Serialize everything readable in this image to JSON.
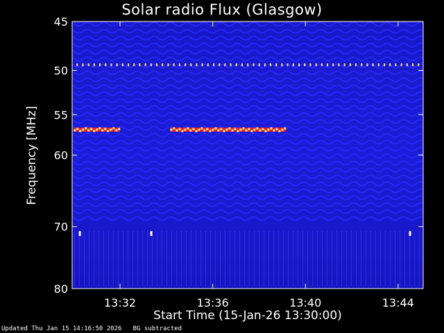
{
  "chart_data": {
    "type": "heatmap",
    "title": "Solar radio Flux (Glasgow)",
    "xlabel": "Start Time (15-Jan-26 13:30:00)",
    "ylabel": "Frequency [MHz]",
    "x_range": [
      "13:29:56",
      "13:45:05"
    ],
    "y_range": [
      45,
      80
    ],
    "y_scale": "log",
    "x_ticks": [
      "13:32",
      "13:36",
      "13:40",
      "13:44"
    ],
    "y_ticks": [
      45,
      50,
      55,
      60,
      70,
      80
    ],
    "features": [
      {
        "kind": "emission-band",
        "freq_mhz": 56.8,
        "start": "13:30:00",
        "end": "13:32:00"
      },
      {
        "kind": "emission-band",
        "freq_mhz": 56.8,
        "start": "13:34:10",
        "end": "13:39:10"
      },
      {
        "kind": "rfi-line",
        "freq_mhz": 49.4,
        "start": "13:30:00",
        "end": "13:45:05"
      },
      {
        "kind": "spike",
        "freq_mhz": 71.0,
        "time": "13:30:15"
      },
      {
        "kind": "spike",
        "freq_mhz": 71.0,
        "time": "13:33:20"
      },
      {
        "kind": "spike",
        "freq_mhz": 71.0,
        "time": "13:44:30"
      }
    ]
  },
  "footer": {
    "updated": "Updated Thu Jan 15 14:16:50 2026",
    "note": "BG subtracted"
  },
  "colors": {
    "background": "#000000",
    "low": "#1a1ad0",
    "mid": "#3030ff",
    "high": "#ff2020",
    "peak": "#ffee80"
  }
}
